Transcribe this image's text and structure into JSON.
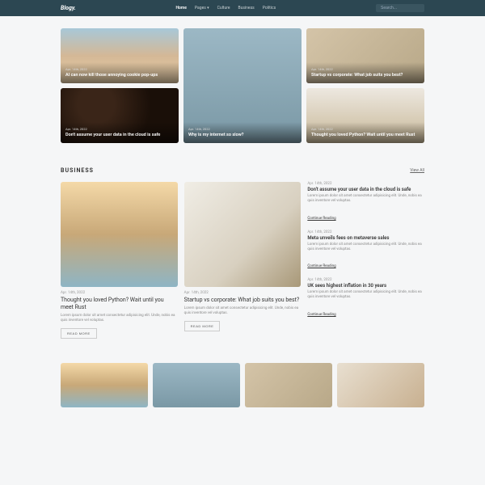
{
  "header": {
    "logo": "Blogy.",
    "nav": [
      "Home",
      "Pages",
      "Culture",
      "Business",
      "Politics"
    ],
    "search_placeholder": "Search..."
  },
  "hero": [
    {
      "date": "Apr. 14th, 2022",
      "title": "AI can now kill those annoying cookie pop-ups",
      "img": "sky1"
    },
    {
      "date": "Apr. 14th, 2022",
      "title": "Why is my internet so slow?",
      "img": "sky2",
      "tall": true
    },
    {
      "date": "Apr. 14th, 2022",
      "title": "Startup vs corporate: What job suits you best?",
      "img": "pampas"
    },
    {
      "date": "Apr. 14th, 2022",
      "title": "Don't assume your user data in the cloud is safe",
      "img": "coffee"
    },
    {
      "date": "Apr. 14th, 2022",
      "title": "Thought you loved Python? Wait until you meet Rust",
      "img": "table"
    }
  ],
  "business": {
    "section_title": "BUSINESS",
    "view_all": "View All",
    "feature": [
      {
        "date": "Apr. 14th, 2022",
        "title": "Thought you loved Python? Wait until you meet Rust",
        "excerpt": "Lorem ipsum dolor sit amet consectetur adipisicing elit. Unde, nobis ea quis inventore vel voluptas.",
        "read": "READ MORE",
        "img": "beach"
      },
      {
        "date": "Apr. 14th, 2022",
        "title": "Startup vs corporate: What job suits you best?",
        "excerpt": "Lorem ipsum dolor sit amet consectetur adipisicing elit. Unde, nobis ea quis inventore vel voluptas.",
        "read": "READ MORE",
        "img": "interior"
      }
    ],
    "side": [
      {
        "date": "Apr. 14th, 2022",
        "title": "Don't assume your user data in the cloud is safe",
        "excerpt": "Lorem ipsum dolor sit amet consectetur adipisicing elit. Unde, nobis ea quis inventore vel voluptas.",
        "cont": "Continue Reading"
      },
      {
        "date": "Apr. 14th, 2022",
        "title": "Meta unveils fees on metaverse sales",
        "excerpt": "Lorem ipsum dolor sit amet consectetur adipisicing elit. Unde, nobis ea quis inventore vel voluptas.",
        "cont": "Continue Reading"
      },
      {
        "date": "Apr. 14th, 2022",
        "title": "UK sees highest inflation in 30 years",
        "excerpt": "Lorem ipsum dolor sit amet consectetur adipisicing elit. Unde, nobis ea quis inventore vel voluptas.",
        "cont": "Continue Reading"
      }
    ]
  },
  "thumbs": [
    "beach",
    "sky2",
    "pampas",
    "bike"
  ]
}
